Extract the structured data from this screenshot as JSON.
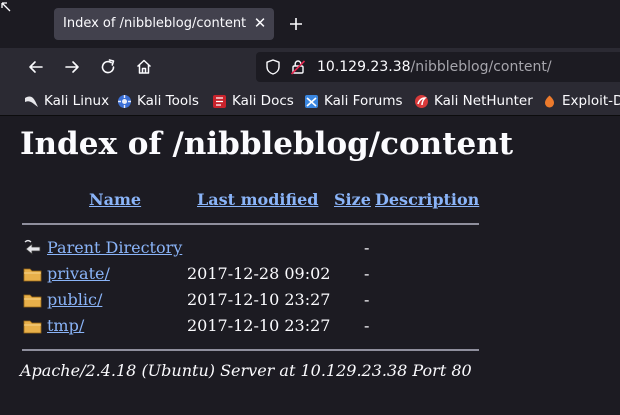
{
  "browser": {
    "tab": {
      "title": "Index of /nibbleblog/content",
      "close_glyph": "✕"
    },
    "newtab_glyph": "+",
    "url": {
      "host": "10.129.23.38",
      "path": "/nibbleblog/content/"
    },
    "icons": {
      "back": "back-arrow-icon",
      "forward": "forward-arrow-icon",
      "reload": "reload-icon",
      "home": "home-icon",
      "shield": "shield-icon",
      "lock": "insecure-lock-icon"
    }
  },
  "bookmarks": [
    {
      "label": "Kali Linux",
      "icon": "kali-dragon-icon"
    },
    {
      "label": "Kali Tools",
      "icon": "kali-tools-icon"
    },
    {
      "label": "Kali Docs",
      "icon": "kali-docs-icon"
    },
    {
      "label": "Kali Forums",
      "icon": "kali-forums-icon"
    },
    {
      "label": "Kali NetHunter",
      "icon": "nethunter-icon"
    },
    {
      "label": "Exploit-D",
      "icon": "exploit-db-icon"
    }
  ],
  "page": {
    "heading": "Index of /nibbleblog/content",
    "columns": {
      "name": "Name",
      "last_modified": "Last modified",
      "size": "Size",
      "description": "Description"
    },
    "entries": [
      {
        "name": "Parent Directory",
        "modified": "",
        "size": "-",
        "icon": "parent-directory-icon"
      },
      {
        "name": "private/",
        "modified": "2017-12-28 09:02",
        "size": "-",
        "icon": "folder-icon"
      },
      {
        "name": "public/",
        "modified": "2017-12-10 23:27",
        "size": "-",
        "icon": "folder-icon"
      },
      {
        "name": "tmp/",
        "modified": "2017-12-10 23:27",
        "size": "-",
        "icon": "folder-icon"
      }
    ],
    "server_signature": "Apache/2.4.18 (Ubuntu) Server at 10.129.23.38 Port 80"
  },
  "colors": {
    "background": "#1c1b22",
    "toolbar": "#2b2a33",
    "link": "#8ab4f8",
    "text": "#fbfbfe",
    "folder": "#e8b04a"
  }
}
